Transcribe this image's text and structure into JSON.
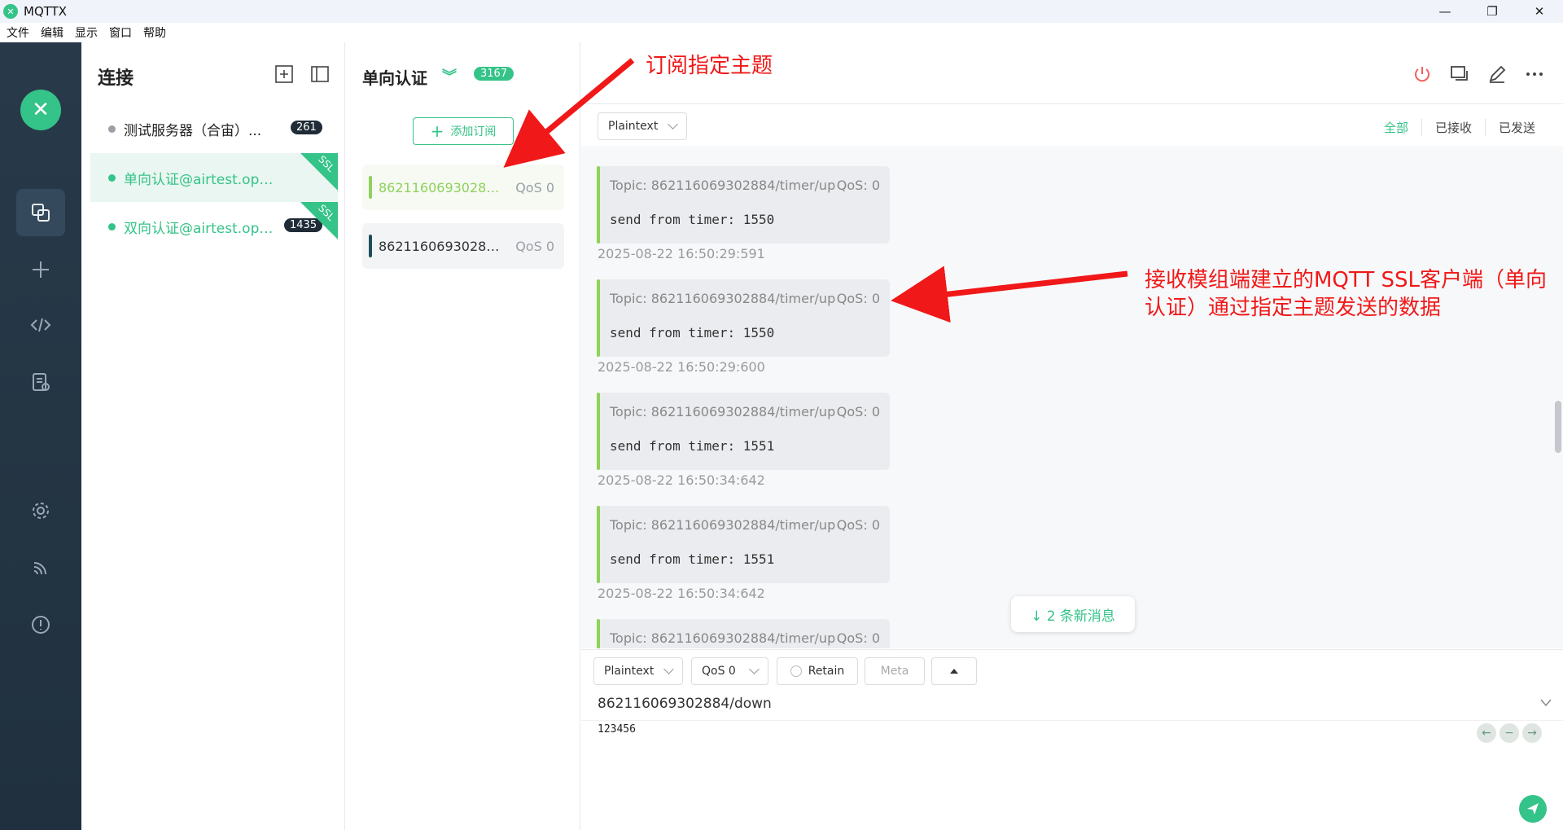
{
  "window": {
    "app_title": "MQTTX",
    "minimize": "—",
    "restore": "❐",
    "close": "✕"
  },
  "menu": [
    "文件",
    "编辑",
    "显示",
    "窗口",
    "帮助"
  ],
  "connections": {
    "title": "连接",
    "items": [
      {
        "name": "测试服务器（合宙）...",
        "badge": "261",
        "status_color": "#9aa0a6",
        "ssl": false,
        "active": false
      },
      {
        "name": "单向认证@airtest.ope...",
        "badge": "",
        "status_color": "#34c388",
        "ssl": true,
        "active": true
      },
      {
        "name": "双向认证@airtest.ope...",
        "badge": "1435",
        "status_color": "#34c388",
        "ssl": true,
        "active": false
      }
    ],
    "ssl_label": "SSL"
  },
  "subscriptions": {
    "connection_title": "单向认证",
    "message_count": "3167",
    "add_label": "添加订阅",
    "items": [
      {
        "topic": "86211606930288...",
        "qos": "QoS 0",
        "color": "#8fd15a",
        "active": true
      },
      {
        "topic": "86211606930288...",
        "qos": "QoS 0",
        "color": "#1f4e5a",
        "active": false
      }
    ]
  },
  "toolbar": {
    "format": "Plaintext",
    "filters": [
      "全部",
      "已接收",
      "已发送"
    ]
  },
  "messages": [
    {
      "topic": "Topic: 862116069302884/timer/up",
      "qos": "QoS: 0",
      "payload": "send from timer: 1550",
      "time": "2025-08-22 16:50:29:591"
    },
    {
      "topic": "Topic: 862116069302884/timer/up",
      "qos": "QoS: 0",
      "payload": "send from timer: 1550",
      "time": "2025-08-22 16:50:29:600"
    },
    {
      "topic": "Topic: 862116069302884/timer/up",
      "qos": "QoS: 0",
      "payload": "send from timer: 1551",
      "time": "2025-08-22 16:50:34:642"
    },
    {
      "topic": "Topic: 862116069302884/timer/up",
      "qos": "QoS: 0",
      "payload": "send from timer: 1551",
      "time": "2025-08-22 16:50:34:642"
    },
    {
      "topic": "Topic: 862116069302884/timer/up",
      "qos": "QoS: 0",
      "payload": "",
      "time": ""
    }
  ],
  "new_messages": "↓ 2 条新消息",
  "composer": {
    "format": "Plaintext",
    "qos": "QoS 0",
    "retain": "Retain",
    "meta": "Meta",
    "topic": "862116069302884/down",
    "payload": "123456"
  },
  "annotations": {
    "subscribe": "订阅指定主题",
    "receive": "接收模组端建立的MQTT SSL客户端（单向认证）通过指定主题发送的数据"
  },
  "colors": {
    "accent": "#34c388",
    "annotation": "#f01818",
    "sidebar": "#283a4a"
  }
}
